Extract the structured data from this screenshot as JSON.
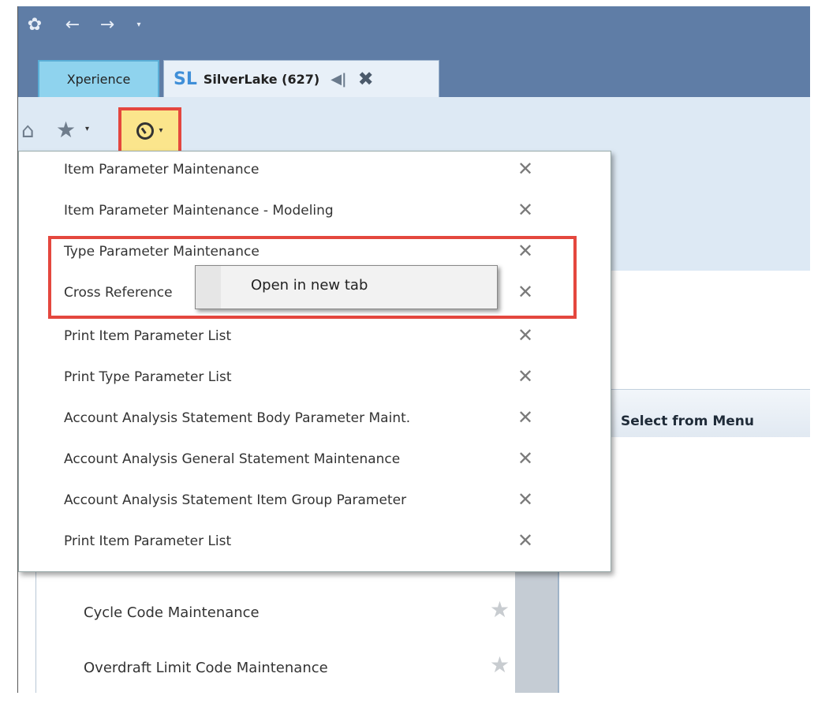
{
  "titlebar": {
    "icons": [
      "app-icon",
      "back-arrow-icon",
      "forward-arrow-icon",
      "dropdown-caret-icon"
    ]
  },
  "tabs": [
    {
      "label": "Xperience"
    },
    {
      "logo": "SL",
      "label": "SilverLake (627)"
    }
  ],
  "toolbar": {
    "icons": [
      "home-icon",
      "favorites-star-icon",
      "history-clock-icon"
    ]
  },
  "history_menu": {
    "items": [
      "Item Parameter Maintenance",
      "Item Parameter Maintenance - Modeling",
      "Type Parameter Maintenance",
      "Cross Reference",
      "Print Item Parameter List",
      "Print Type Parameter List",
      "Account Analysis Statement Body Parameter Maint.",
      "Account Analysis General Statement Maintenance",
      "Account Analysis Statement Item Group Parameter",
      "Print Item Parameter List"
    ]
  },
  "context_menu": {
    "item": "Open in new tab"
  },
  "select_panel": {
    "title": "Select from Menu"
  },
  "background_list": {
    "items": [
      "Cycle Code Maintenance",
      "Overdraft Limit Code Maintenance"
    ]
  }
}
